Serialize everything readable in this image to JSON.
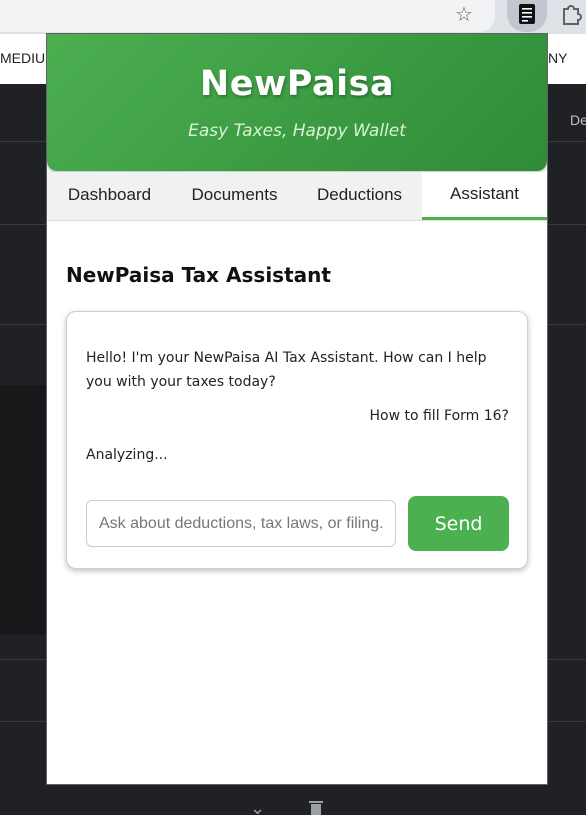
{
  "browser": {
    "bookmark_left": "MEDIUM",
    "bookmark_right": "NY",
    "side_text": "De",
    "icons": [
      "star-icon",
      "document-icon",
      "puzzle-icon",
      "chevron-down-icon",
      "trash-icon"
    ]
  },
  "header": {
    "title": "NewPaisa",
    "tagline": "Easy Taxes, Happy Wallet"
  },
  "tabs": [
    {
      "label": "Dashboard",
      "active": false
    },
    {
      "label": "Documents",
      "active": false
    },
    {
      "label": "Deductions",
      "active": false
    },
    {
      "label": "Assistant",
      "active": true
    }
  ],
  "assistant": {
    "title": "NewPaisa Tax Assistant",
    "messages": {
      "bot": "Hello! I'm your NewPaisa AI Tax Assistant. How can I help you with your taxes today?",
      "user": "How to fill Form 16?",
      "status": "Analyzing..."
    },
    "input": {
      "value": "",
      "placeholder": "Ask about deductions, tax laws, or filing..."
    },
    "send_label": "Send"
  },
  "colors": {
    "accent": "#4caf50",
    "header_dark": "#2e8b37",
    "tagline": "#d8f3d5"
  }
}
